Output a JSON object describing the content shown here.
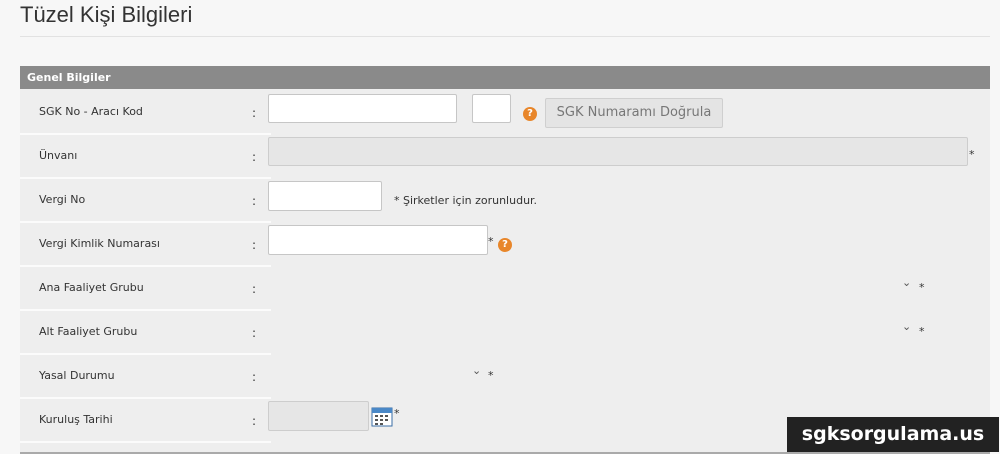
{
  "page": {
    "title": "Tüzel Kişi Bilgileri"
  },
  "panel": {
    "header": "Genel Bilgiler"
  },
  "form": {
    "colon": ":",
    "required_mark": "*",
    "help_glyph": "?",
    "chevron_glyph": "⌄",
    "sgk": {
      "label": "SGK No - Aracı Kod",
      "value": "",
      "code_value": "",
      "verify_button": "SGK Numaramı Doğrula"
    },
    "unvan": {
      "label": "Ünvanı",
      "value": ""
    },
    "vergi_no": {
      "label": "Vergi No",
      "value": "",
      "note": "* Şirketler için zorunludur."
    },
    "vkn": {
      "label": "Vergi Kimlik Numarası",
      "value": ""
    },
    "ana_faaliyet": {
      "label": "Ana Faaliyet Grubu",
      "selected": ""
    },
    "alt_faaliyet": {
      "label": "Alt Faaliyet Grubu",
      "selected": ""
    },
    "yasal_durum": {
      "label": "Yasal Durumu",
      "selected": ""
    },
    "kurulus_tarihi": {
      "label": "Kuruluş Tarihi",
      "value": ""
    }
  },
  "watermark": "sgksorgulama.us",
  "colors": {
    "header_bg": "#8a8a8a",
    "panel_bg": "#eeeeee",
    "help_icon": "#e8862a"
  }
}
